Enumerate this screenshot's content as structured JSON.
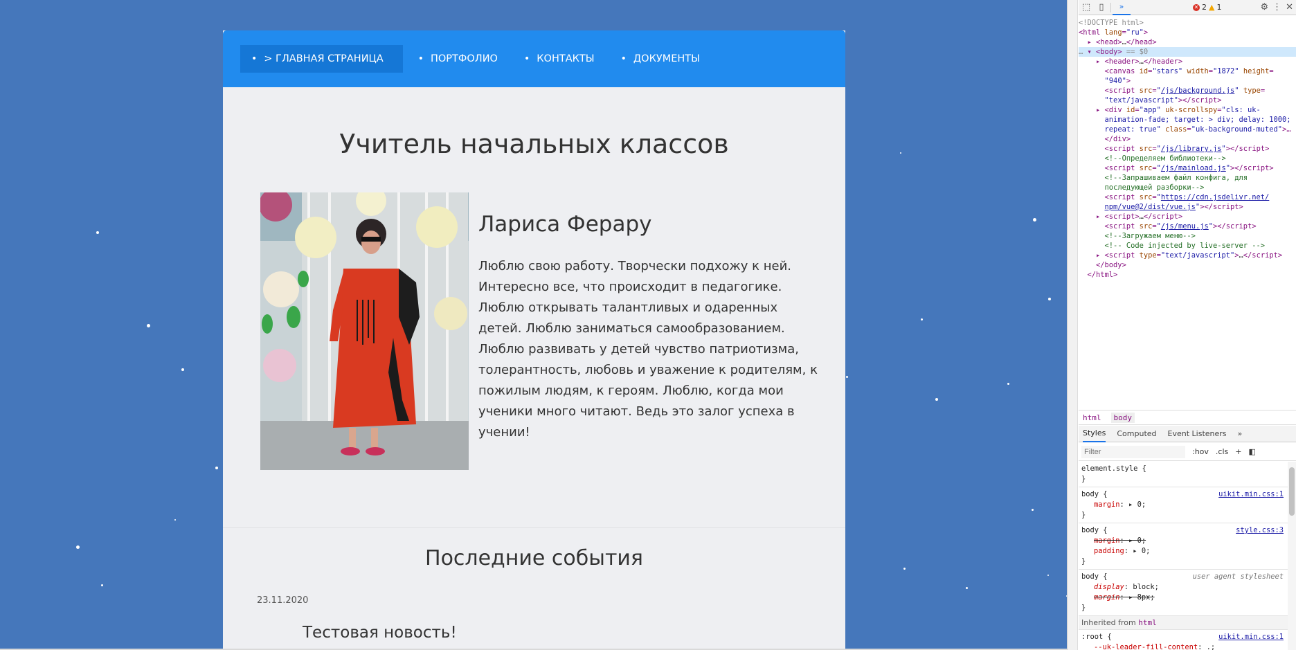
{
  "nav": {
    "items": [
      {
        "label": "> ГЛАВНАЯ СТРАНИЦА"
      },
      {
        "label": "ПОРТФОЛИО"
      },
      {
        "label": "КОНТАКТЫ"
      },
      {
        "label": "ДОКУМЕНТЫ"
      }
    ]
  },
  "hero": {
    "title": "Учитель начальных классов"
  },
  "profile": {
    "name": "Лариса Ферару",
    "bio": "Люблю свою работу. Творчески подхожу к ней. Интересно все, что происходит в педагогике. Люблю открывать талантливых и одаренных детей. Люблю заниматься самообразованием. Люблю развивать у детей чувство патриотизма, толерантность, любовь и уважение к родителям, к пожилым людям, к героям. Люблю, когда мои ученики много читают. Ведь это залог успеха в учении!"
  },
  "events": {
    "title": "Последние события",
    "items": [
      {
        "date": "23.11.2020",
        "title": "Тестовая новость!"
      }
    ]
  },
  "colors": {
    "page_bg": "#4577bb",
    "navbar": "#218bee",
    "navbar_active": "#1577d6",
    "card_bg": "#eeeff2"
  },
  "devtools": {
    "toolbar": {
      "errors": "2",
      "warnings": "1"
    },
    "breadcrumb": [
      "html",
      "body"
    ],
    "tabs": [
      "Styles",
      "Computed",
      "Event Listeners"
    ],
    "filter_placeholder": "Filter",
    "filter_buttons": [
      ":hov",
      ".cls",
      "+"
    ],
    "inherited_label": "Inherited from",
    "inherited_tag": "html"
  }
}
